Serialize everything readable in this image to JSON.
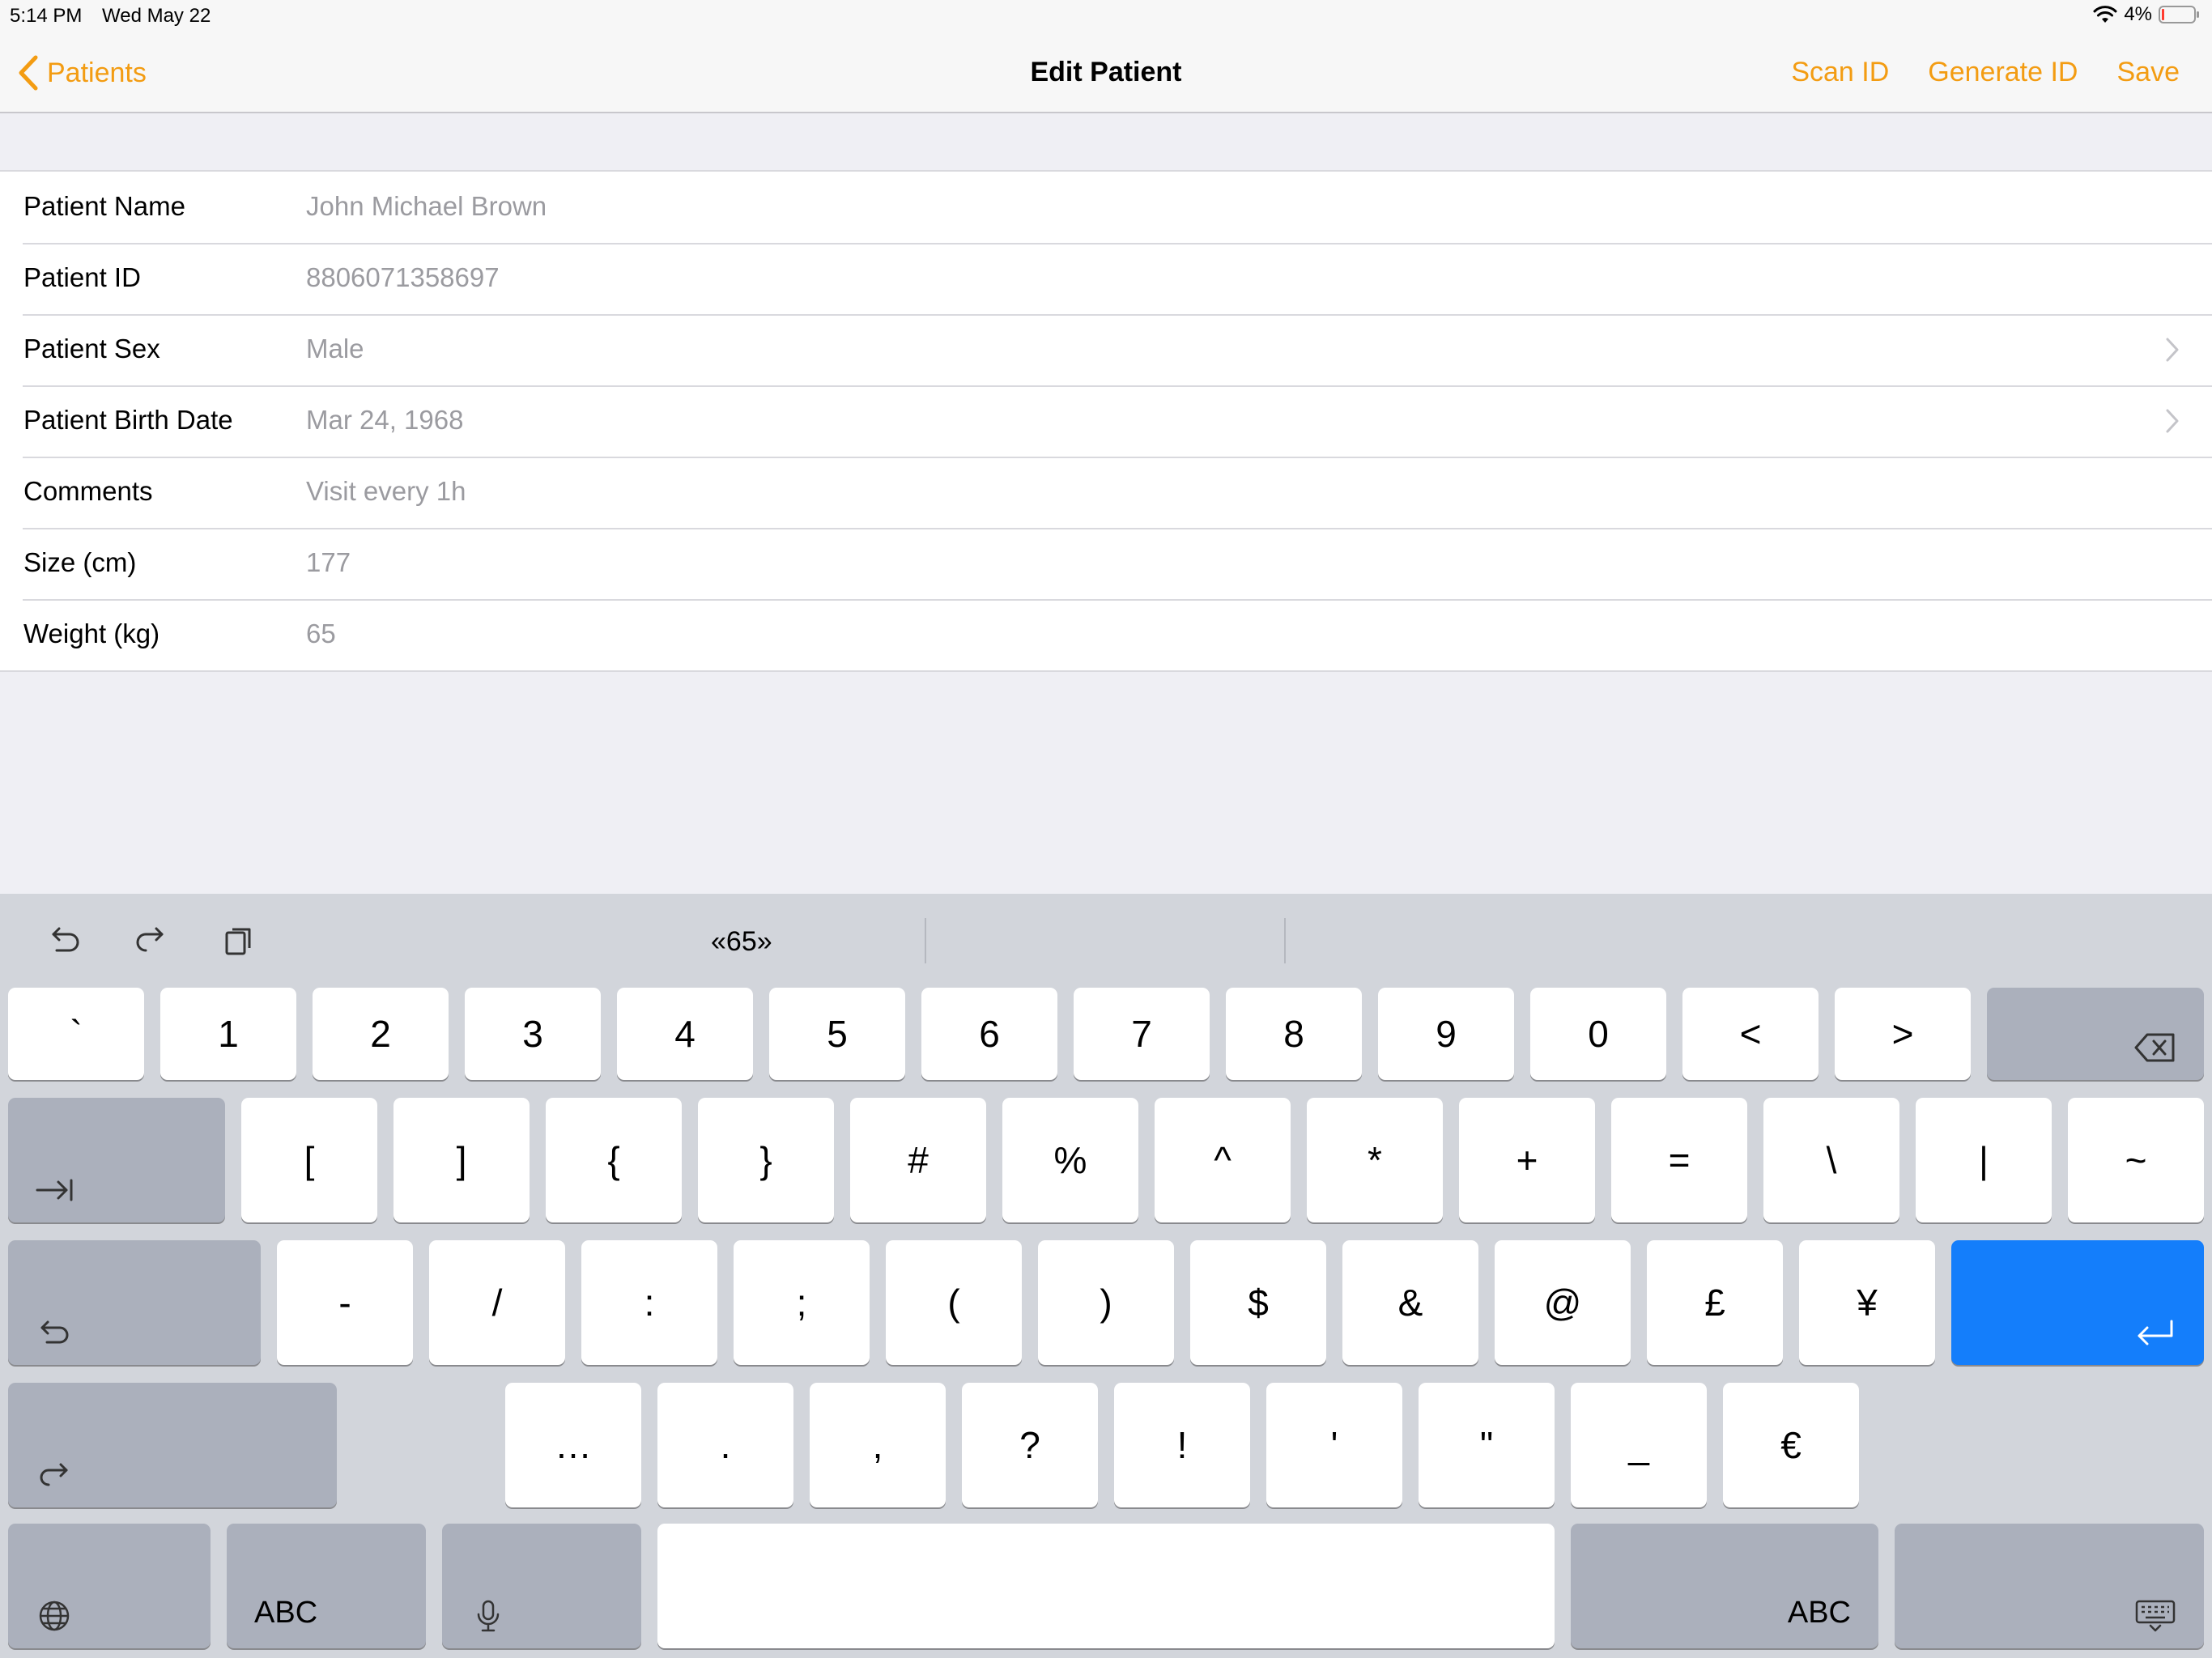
{
  "status_bar": {
    "time": "5:14 PM",
    "date": "Wed May 22",
    "battery": "4%"
  },
  "nav": {
    "back_label": "Patients",
    "title": "Edit Patient",
    "actions": [
      "Scan ID",
      "Generate ID",
      "Save"
    ]
  },
  "form": {
    "rows": [
      {
        "label": "Patient Name",
        "value": "John Michael Brown"
      },
      {
        "label": "Patient ID",
        "value": "8806071358697"
      },
      {
        "label": "Patient Sex",
        "value": "Male"
      },
      {
        "label": "Patient Birth Date",
        "value": "Mar 24, 1968"
      },
      {
        "label": "Comments",
        "value": "Visit every 1h"
      },
      {
        "label": "Size (cm)",
        "value": "177"
      },
      {
        "label": "Weight (kg)",
        "value": "65"
      }
    ]
  },
  "keyboard": {
    "prediction": "«65»",
    "row1": [
      "`",
      "1",
      "2",
      "3",
      "4",
      "5",
      "6",
      "7",
      "8",
      "9",
      "0",
      "<",
      ">"
    ],
    "row2": [
      "[",
      "]",
      "{",
      "}",
      "#",
      "%",
      "^",
      "*",
      "+",
      "=",
      "\\",
      "|",
      "~"
    ],
    "row3": [
      "-",
      "/",
      ":",
      ";",
      "(",
      ")",
      "$",
      "&",
      "@",
      "£",
      "¥"
    ],
    "row4": [
      "…",
      ".",
      ",",
      "?",
      "!",
      "'",
      "\"",
      "_",
      "€"
    ],
    "abc_left": "ABC",
    "abc_right": "ABC"
  },
  "colors": {
    "accent": "#f39c12",
    "return_key": "#147efb"
  }
}
